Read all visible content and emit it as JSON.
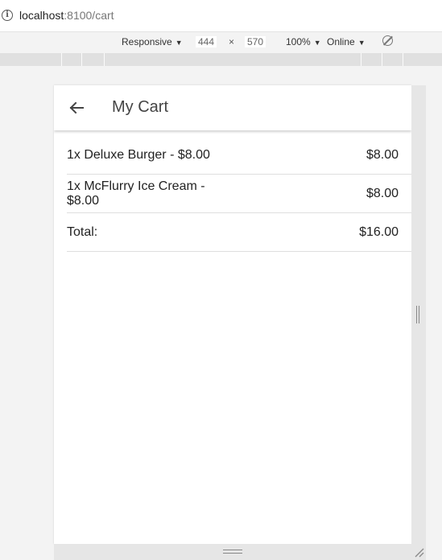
{
  "browser": {
    "url_host": "localhost",
    "url_path": ":8100/cart"
  },
  "devtools": {
    "device": "Responsive",
    "width": "444",
    "times": "×",
    "height": "570",
    "zoom": "100%",
    "network": "Online"
  },
  "app": {
    "title": "My Cart",
    "items": [
      {
        "name": "1x Deluxe Burger - $8.00",
        "price": "$8.00"
      },
      {
        "name": "1x McFlurry Ice Cream - $8.00",
        "price": "$8.00"
      }
    ],
    "total_label": "Total:",
    "total_value": "$16.00"
  }
}
